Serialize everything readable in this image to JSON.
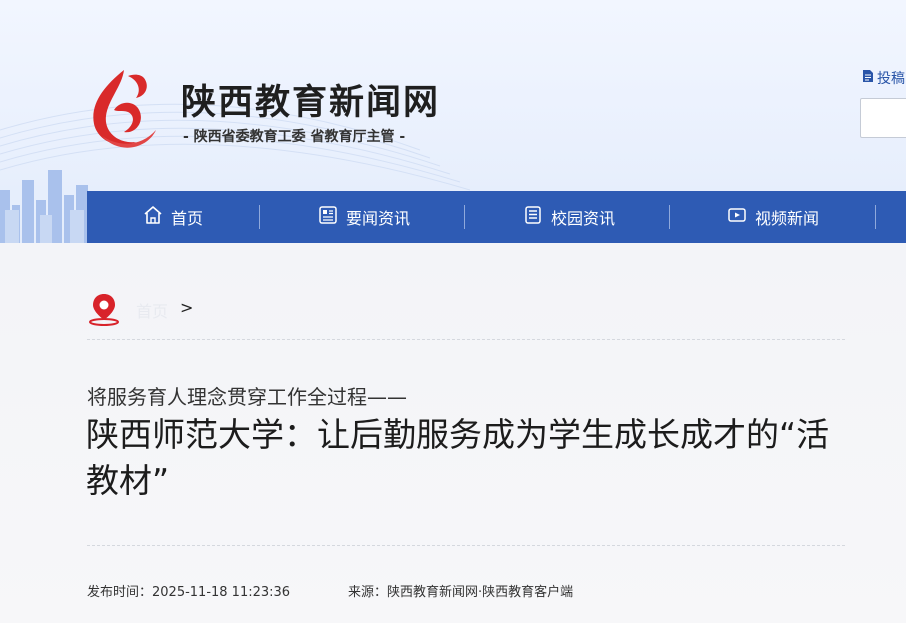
{
  "site": {
    "name": "陕西教育新闻网",
    "subtitle": "- 陕西省委教育工委  省教育厅主管 -"
  },
  "top_right": {
    "submit_label": "投稿"
  },
  "nav": {
    "items": [
      {
        "label": "首页",
        "icon": "home-icon"
      },
      {
        "label": "要闻资讯",
        "icon": "news-icon"
      },
      {
        "label": "校园资讯",
        "icon": "list-icon"
      },
      {
        "label": "视频新闻",
        "icon": "video-icon"
      }
    ]
  },
  "breadcrumb": {
    "home": "首页",
    "separator": ">"
  },
  "article": {
    "subtitle": "将服务育人理念贯穿工作全过程——",
    "title": "陕西师范大学：让后勤服务成为学生成长成才的“活教材”",
    "publish_time": "发布时间：2025-11-18 11:23:36",
    "source": "来源：陕西教育新闻网·陕西教育客户端"
  },
  "colors": {
    "nav_bg": "#2e5bb4",
    "logo_red": "#d92a2a",
    "breadcrumb_pin": "#d8232a"
  }
}
